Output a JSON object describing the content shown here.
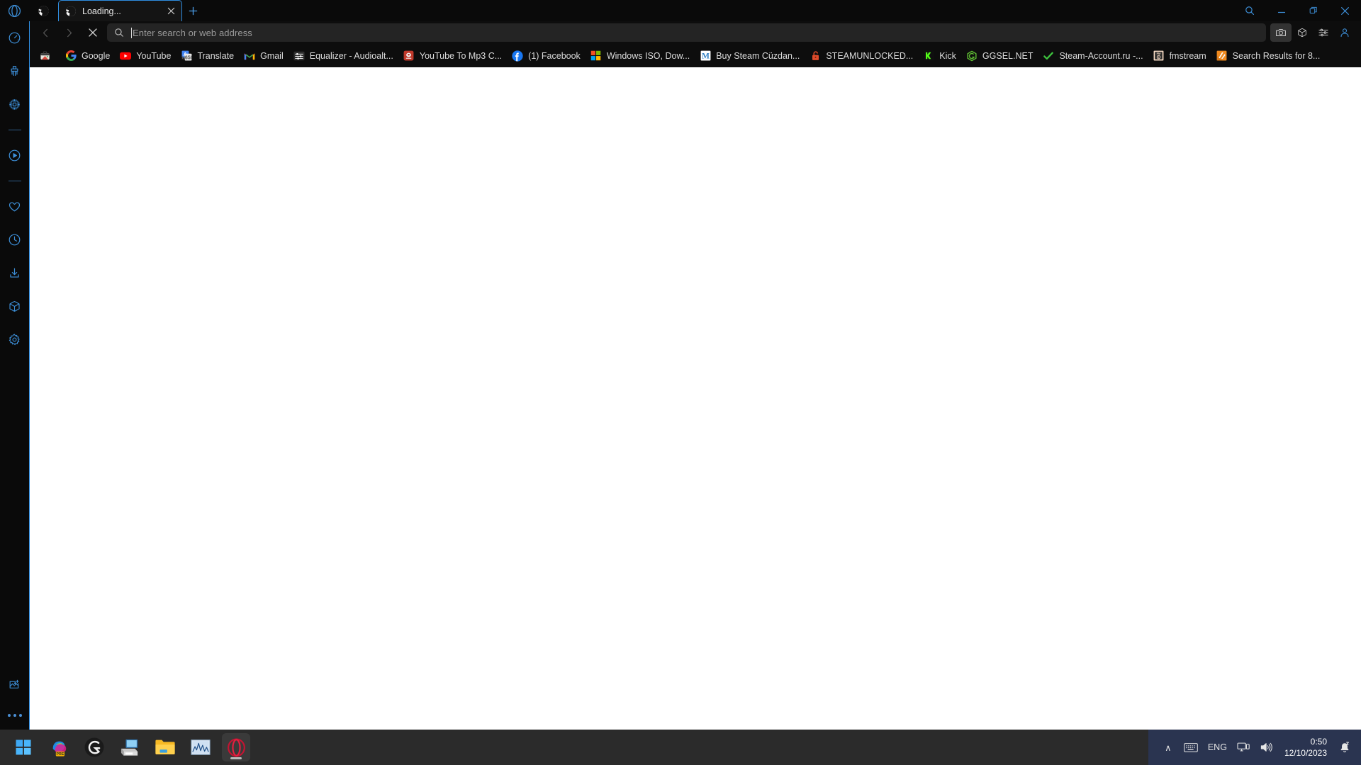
{
  "browser": {
    "name": "Opera GX",
    "window_controls": [
      {
        "name": "search-window-button",
        "icon": "search-icon"
      },
      {
        "name": "minimize-button",
        "icon": "minimize-icon"
      },
      {
        "name": "maximize-button",
        "icon": "maximize-icon"
      },
      {
        "name": "close-button",
        "icon": "close-icon"
      }
    ],
    "tabstrip": {
      "pinned_tab_icon": "opera-globe-icon",
      "active_tab": {
        "title": "Loading...",
        "favicon": "globe-icon",
        "close_label": "×"
      },
      "new_tab_label": "+"
    },
    "navbar": {
      "back_label": "‹",
      "forward_label": "›",
      "stop_label": "×",
      "address": {
        "value": "",
        "placeholder": "Enter search or web address",
        "search_icon": "search-icon"
      },
      "right_icons": [
        {
          "name": "snapshot-button",
          "icon": "camera-icon",
          "active": true
        },
        {
          "name": "extensions-button",
          "icon": "cube-icon",
          "active": false
        },
        {
          "name": "easy-setup-button",
          "icon": "sliders-icon",
          "active": false
        },
        {
          "name": "profile-button",
          "icon": "person-icon",
          "active": false
        }
      ]
    },
    "sidebar": {
      "logo": "opera-gx-logo",
      "items": [
        {
          "name": "sidebar-item-speedometer",
          "icon": "speedometer-icon"
        },
        {
          "name": "sidebar-item-cleaner",
          "icon": "broom-icon"
        },
        {
          "name": "sidebar-item-gx-control",
          "icon": "cpu-chip-icon"
        },
        {
          "name": "sidebar-divider-1",
          "icon": "divider"
        },
        {
          "name": "sidebar-item-player",
          "icon": "play-circle-icon"
        },
        {
          "name": "sidebar-divider-2",
          "icon": "divider"
        },
        {
          "name": "sidebar-item-favorites",
          "icon": "heart-icon"
        },
        {
          "name": "sidebar-item-history",
          "icon": "clock-icon"
        },
        {
          "name": "sidebar-item-downloads",
          "icon": "download-icon"
        },
        {
          "name": "sidebar-item-extensions",
          "icon": "cube-icon"
        },
        {
          "name": "sidebar-item-settings",
          "icon": "gear-icon"
        }
      ],
      "bottom_items": [
        {
          "name": "sidebar-item-snapshot",
          "icon": "image-plus-icon"
        },
        {
          "name": "sidebar-item-more",
          "icon": "more-dots-icon"
        }
      ]
    },
    "bookmarks": [
      {
        "label": "",
        "icon": "briefcase-icon",
        "icon_kind": "briefcase"
      },
      {
        "label": "Google",
        "icon": "google-icon",
        "icon_kind": "google"
      },
      {
        "label": "YouTube",
        "icon": "youtube-icon",
        "icon_kind": "youtube"
      },
      {
        "label": "Translate",
        "icon": "google-translate-icon",
        "icon_kind": "translate"
      },
      {
        "label": "Gmail",
        "icon": "gmail-icon",
        "icon_kind": "gmail"
      },
      {
        "label": "Equalizer - Audioalt...",
        "icon": "equalizer-icon",
        "icon_kind": "equalizer"
      },
      {
        "label": "YouTube To Mp3 C...",
        "icon": "converter-icon",
        "icon_kind": "converter"
      },
      {
        "label": "(1) Facebook",
        "icon": "facebook-icon",
        "icon_kind": "facebook"
      },
      {
        "label": "Windows ISO, Dow...",
        "icon": "windows-icon",
        "icon_kind": "windows"
      },
      {
        "label": "Buy Steam Cüzdan...",
        "icon": "m-letter-icon",
        "icon_kind": "mletter"
      },
      {
        "label": "STEAMUNLOCKED...",
        "icon": "unlock-icon",
        "icon_kind": "unlock"
      },
      {
        "label": "Kick",
        "icon": "kick-icon",
        "icon_kind": "kick"
      },
      {
        "label": "GGSEL.NET",
        "icon": "ggsel-icon",
        "icon_kind": "ggsel"
      },
      {
        "label": "Steam-Account.ru -...",
        "icon": "check-icon",
        "icon_kind": "check"
      },
      {
        "label": "fmstream",
        "icon": "fmstream-icon",
        "icon_kind": "fmstream"
      },
      {
        "label": "Search Results for 8...",
        "icon": "orange-slash-icon",
        "icon_kind": "orange"
      }
    ]
  },
  "taskbar": {
    "apps": [
      {
        "name": "start-button",
        "icon": "windows-start-icon",
        "running": false
      },
      {
        "name": "copilot-button",
        "icon": "copilot-pre-icon",
        "running": false
      },
      {
        "name": "logitech-g-hub-button",
        "icon": "logitech-g-icon",
        "running": false
      },
      {
        "name": "display-driver-button",
        "icon": "monitor-printer-icon",
        "running": false
      },
      {
        "name": "file-explorer-button",
        "icon": "folder-icon",
        "running": false
      },
      {
        "name": "task-manager-button",
        "icon": "chart-icon",
        "running": false
      },
      {
        "name": "opera-gx-button",
        "icon": "opera-gx-icon",
        "running": true
      }
    ],
    "tray": {
      "overflow_label": "∧",
      "keyboard_icon": "keyboard-icon",
      "language": "ENG",
      "network_icon": "network-icon",
      "volume_icon": "volume-icon",
      "time": "0:50",
      "date": "12/10/2023",
      "notification_icon": "bell-sleep-icon"
    }
  },
  "colors": {
    "accent_blue": "#2f8de0",
    "sidebar_bg": "#0a0a0a",
    "chrome_bg": "#0d0d0d",
    "tab_bg": "#141414",
    "address_bg": "#242424",
    "content_bg": "#ffffff",
    "taskbar_bg": "#2b2b2b",
    "tray_bg": "#2a3450"
  }
}
